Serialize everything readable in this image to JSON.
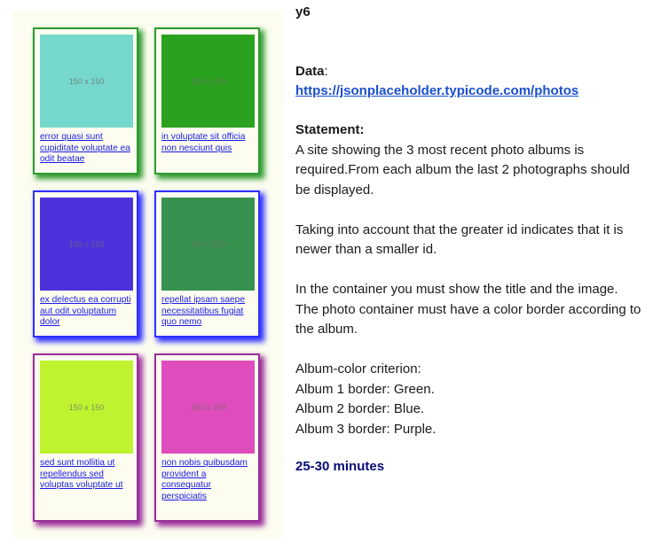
{
  "cards": [
    {
      "placeholder": "150 x 150",
      "color": "#76d8cc",
      "title": "error quasi sunt cupiditate voluptate ea odit beatae",
      "album": 1
    },
    {
      "placeholder": "150 x 150",
      "color": "#2aa21f",
      "title": "in voluptate sit officia non nesciunt quis",
      "album": 1
    },
    {
      "placeholder": "150 x 150",
      "color": "#4f31dc",
      "title": "ex delectus ea corrupti aut odit voluptatum dolor",
      "album": 2
    },
    {
      "placeholder": "150 x 150",
      "color": "#37914f",
      "title": "repellat ipsam saepe necessitatibus fugiat quo nemo",
      "album": 2
    },
    {
      "placeholder": "150 x 150",
      "color": "#bff330",
      "title": "sed sunt mollitia ut repellendus sed voluptas voluptate ut",
      "album": 3
    },
    {
      "placeholder": "150 x 150",
      "color": "#df4cbb",
      "title": "non nobis quibusdam provident a consequatur perspiciatis",
      "album": 3
    }
  ],
  "info": {
    "heading": "y6",
    "data_label": "Data",
    "data_url": "https://jsonplaceholder.typicode.com/photos",
    "statement_label": "Statement:",
    "statement": "A site showing the 3 most recent photo albums is required.From each album the last 2 photographs should be displayed.",
    "note": "Taking into account that the greater id indicates that it is newer than a smaller id.",
    "container": "In the container you must show the title and the image. The photo container must have a color border according to the album.",
    "criterion_label": "Album-color criterion:",
    "criteria": [
      "Album 1 border: Green.",
      "Album 2 border: Blue.",
      "Album 3 border: Purple."
    ],
    "time": "25-30 minutes"
  }
}
